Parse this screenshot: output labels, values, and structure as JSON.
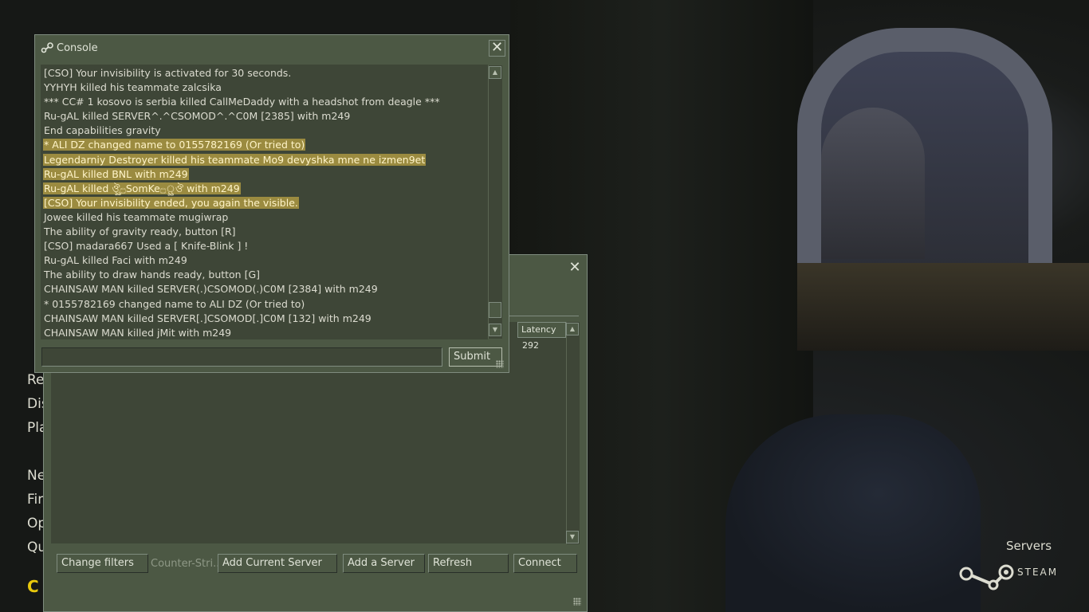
{
  "console": {
    "title": "Console",
    "close_label": "✕",
    "lines": [
      {
        "text": "[CSO] Your invisibility is activated for 30 seconds.",
        "highlight": false
      },
      {
        "text": "YYHYH killed his teammate zalcsika",
        "highlight": false
      },
      {
        "text": "*** CC# 1 kosovo is serbia killed CallMeDaddy with a headshot from deagle ***",
        "highlight": false
      },
      {
        "text": "Ru-gAL killed SERVER^.^CSOMOD^.^C0M [2385] with m249",
        "highlight": false
      },
      {
        "text": "End capabilities gravity",
        "highlight": false
      },
      {
        "text": "* ALI DZ changed name to 0155782169 (Or tried to)",
        "highlight": true
      },
      {
        "text": "Legendarniy Destroyer killed his teammate Mo9 devyshka mne ne izmen9et",
        "highlight": true
      },
      {
        "text": "Ru-gAL killed BNL with m249",
        "highlight": true
      },
      {
        "text": "Ru-gAL killed ঔৣ۝SomKe۝ৣঔ with m249",
        "highlight": true
      },
      {
        "text": "[CSO] Your invisibility ended, you again the visible.",
        "highlight": true
      },
      {
        "text": "Jowee killed his teammate mugiwrap",
        "highlight": false
      },
      {
        "text": "The ability of gravity ready, button [R]",
        "highlight": false
      },
      {
        "text": "[CSO] madara667 Used a [ Knife-Blink ] !",
        "highlight": false
      },
      {
        "text": "Ru-gAL killed Faci with m249",
        "highlight": false
      },
      {
        "text": "The ability to draw hands ready, button [G]",
        "highlight": false
      },
      {
        "text": "CHAINSAW MAN killed SERVER(.)CSOMOD(.)C0M [2384] with m249",
        "highlight": false
      },
      {
        "text": "* 0155782169 changed name to ALI DZ (Or tried to)",
        "highlight": false
      },
      {
        "text": "CHAINSAW MAN killed SERVER[.]CSOMOD[.]C0M [132] with m249",
        "highlight": false
      },
      {
        "text": "CHAINSAW MAN killed jMit with m249",
        "highlight": false
      }
    ],
    "input_value": "",
    "submit_label": "Submit"
  },
  "server_browser": {
    "close_label": "✕",
    "columns": {
      "latency": "Latency"
    },
    "rows": [
      {
        "latency": "292"
      }
    ],
    "filter_summary": "Counter-Stri...",
    "buttons": {
      "change_filters": "Change filters",
      "add_current_server": "Add Current Server",
      "add_server": "Add a Server",
      "refresh": "Refresh",
      "connect": "Connect"
    }
  },
  "main_menu": {
    "items": [
      "Re",
      "Dis",
      "Pla",
      "Ne",
      "Fin",
      "Op",
      "Qu"
    ],
    "logo_fragment": "C"
  },
  "footer": {
    "section_label": "Servers",
    "steam_label": "STEAM"
  },
  "colors": {
    "panel": "#4c5844",
    "panel_dark": "#3e4637",
    "border_light": "#7f8c7f",
    "text": "#dfe3d7",
    "highlight": "#9b8b40",
    "logo_yellow": "#e8c80c"
  }
}
